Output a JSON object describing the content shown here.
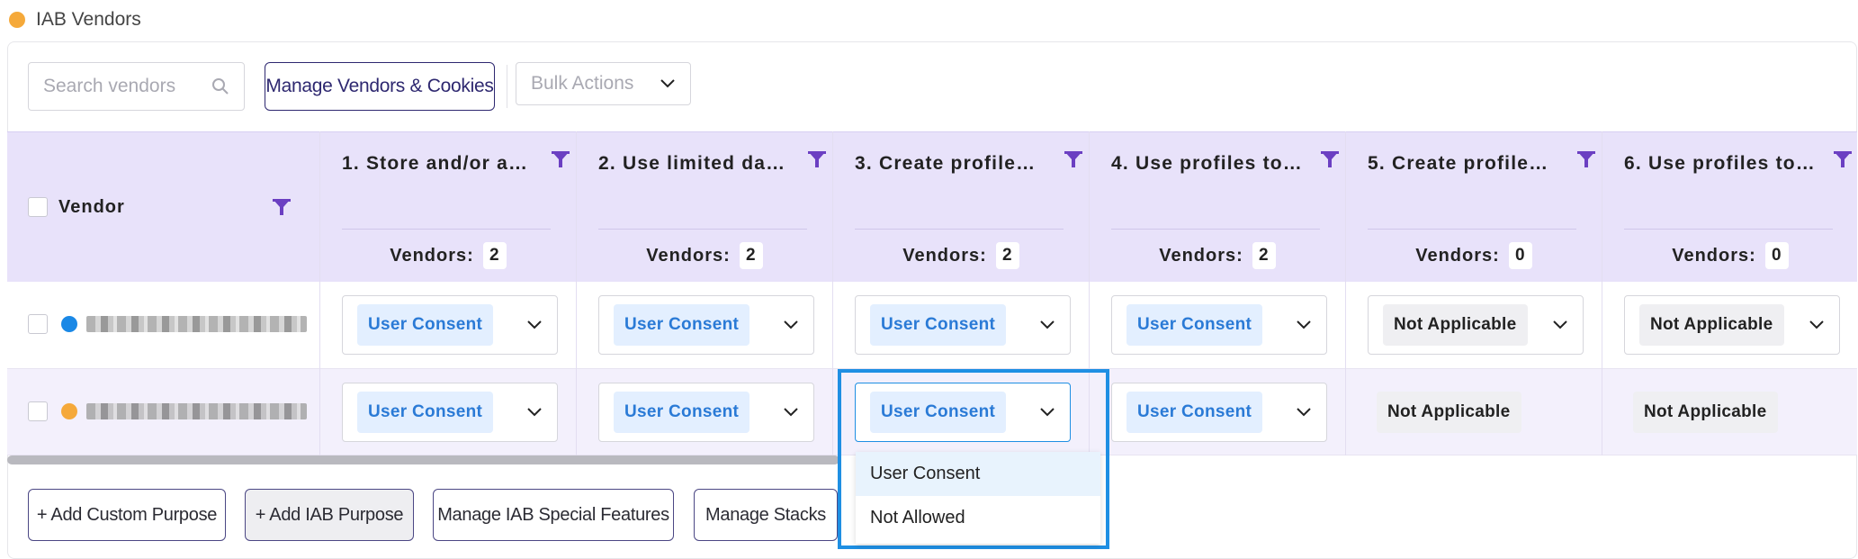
{
  "section": {
    "title": "IAB Vendors",
    "dot_color": "#f5a93a"
  },
  "toolbar": {
    "search_placeholder": "Search vendors",
    "manage_label": "Manage Vendors & Cookies",
    "bulk_label": "Bulk Actions"
  },
  "table": {
    "vendor_header": "Vendor",
    "vendors_label": "Vendors:",
    "purposes": [
      {
        "title": "1. Store and/or a…",
        "count": "2"
      },
      {
        "title": "2. Use limited da…",
        "count": "2"
      },
      {
        "title": "3. Create profile…",
        "count": "2"
      },
      {
        "title": "4. Use profiles to…",
        "count": "2"
      },
      {
        "title": "5. Create profile…",
        "count": "0"
      },
      {
        "title": "6. Use profiles to…",
        "count": "0"
      }
    ],
    "rows": [
      {
        "dot_color": "#1a88e6",
        "cells": [
          "User Consent",
          "User Consent",
          "User Consent",
          "User Consent",
          "Not Applicable",
          "Not Applicable"
        ]
      },
      {
        "dot_color": "#f5a93a",
        "cells": [
          "User Consent",
          "User Consent",
          "User Consent",
          "User Consent",
          "Not Applicable",
          "Not Applicable"
        ]
      }
    ]
  },
  "dropdown": {
    "options": [
      "User Consent",
      "Not Allowed"
    ],
    "selected": "User Consent"
  },
  "footer": {
    "add_custom": "+ Add Custom Purpose",
    "add_iab": "+ Add IAB Purpose",
    "special_features": "Manage IAB Special Features",
    "stacks": "Manage Stacks"
  },
  "colors": {
    "accent_purple": "#6b3fc2",
    "header_bg": "#e8e2fa",
    "consent_chip_bg": "#e3efff",
    "consent_chip_text": "#2a7ad6",
    "highlight_blue": "#1f8fe3"
  }
}
